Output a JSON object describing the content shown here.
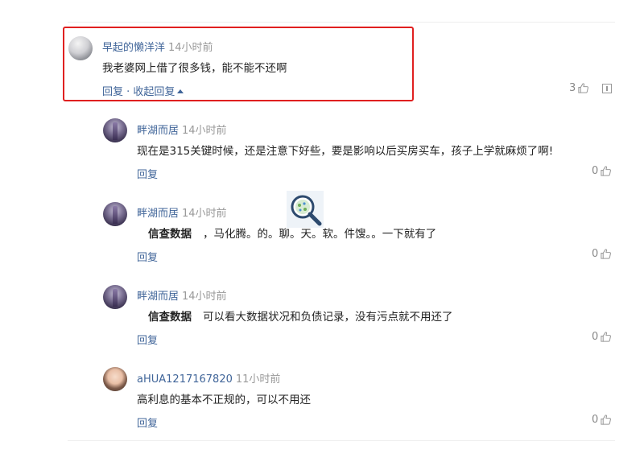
{
  "comments": [
    {
      "username": "早起的懒洋洋",
      "time": "14小时前",
      "text": "我老婆网上借了很多钱，能不能不还啊",
      "reply": "回复",
      "separator": " · ",
      "collapse": "收起回复",
      "likes": "3"
    },
    {
      "username": "畔湖而居",
      "time": "14小时前",
      "text": "现在是315关键时候，还是注意下好些，要是影响以后买房买车，孩子上学就麻烦了啊!",
      "reply": "回复",
      "likes": "0"
    },
    {
      "username": "畔湖而居",
      "time": "14小时前",
      "prefix": "信查数据",
      "text": "，马化腾。的。聊。天。软。件馊。。一下就有了",
      "reply": "回复",
      "likes": "0"
    },
    {
      "username": "畔湖而居",
      "time": "14小时前",
      "prefix": "信查数据",
      "text": "可以看大数据状况和负债记录，没有污点就不用还了",
      "reply": "回复",
      "likes": "0"
    },
    {
      "username": "aHUA1217167820",
      "time": "11小时前",
      "text": "高利息的基本不正规的，可以不用还",
      "reply": "回复",
      "likes": "0"
    }
  ],
  "colors": {
    "link": "#406599",
    "highlight_border": "#e02020",
    "muted": "#999999"
  },
  "icons": {
    "like": "thumbs-up-icon",
    "report": "report-icon",
    "overlay": "magnifier-icon"
  }
}
